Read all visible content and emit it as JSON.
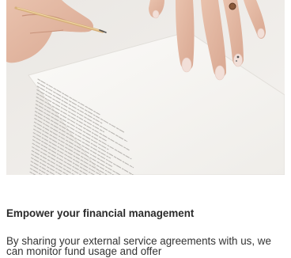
{
  "article": {
    "image": {
      "subject": "hands-signing-document"
    },
    "heading": "Empower your financial management",
    "body": "By sharing your external service agreements with us, we can monitor fund usage and offer"
  },
  "colors": {
    "heading": "#2b2b2b",
    "body": "#333333",
    "page_background": "#ffffff",
    "nail_polish": "#f2dfd8"
  }
}
